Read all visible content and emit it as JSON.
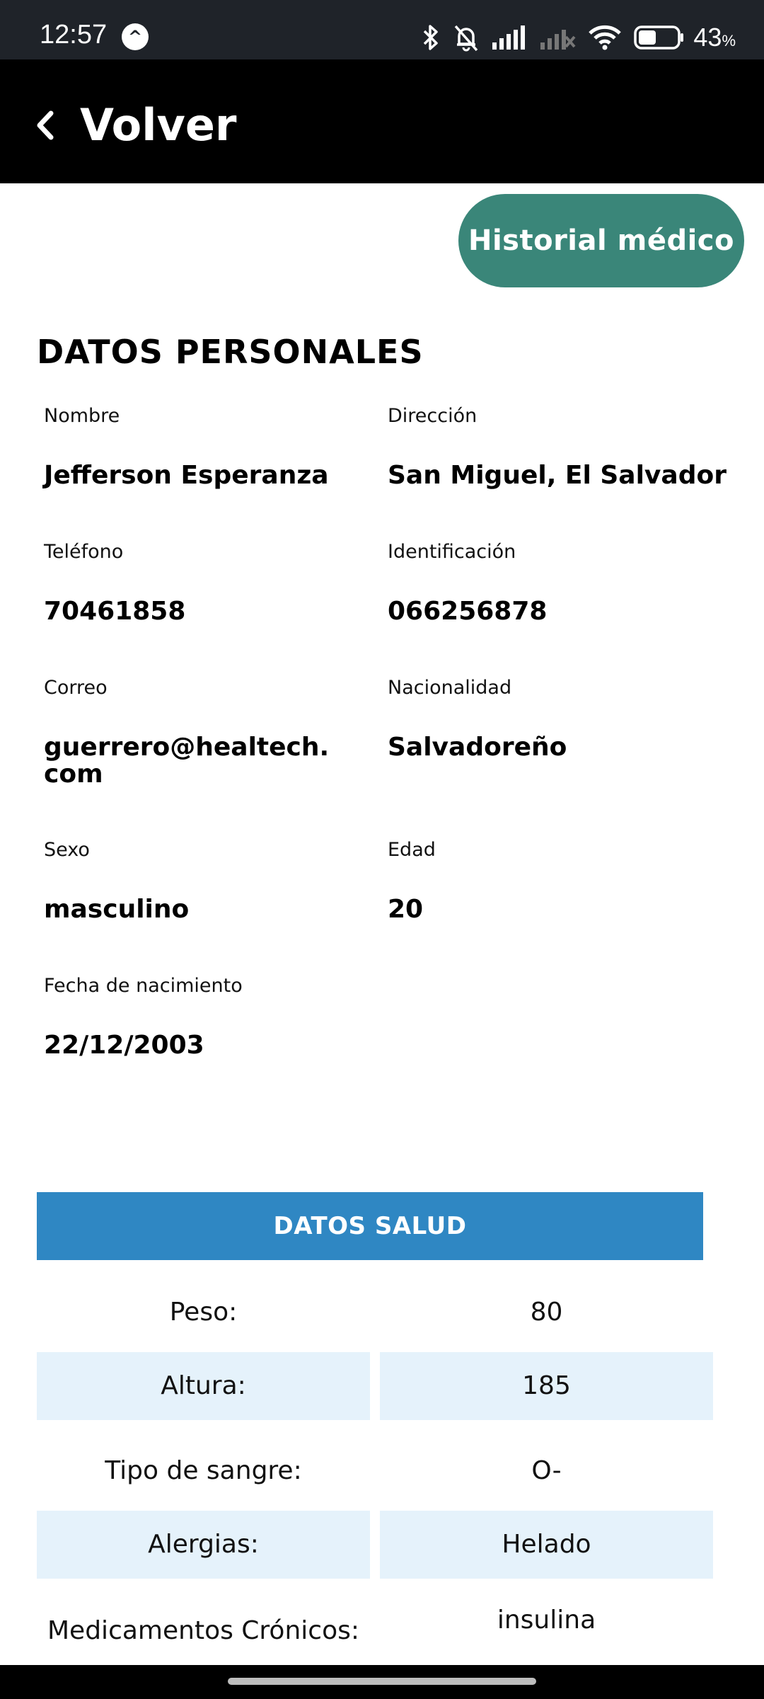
{
  "status_bar": {
    "time": "12:57",
    "app_icon_glyph": "^",
    "battery": "43",
    "battery_unit": "%",
    "icons": [
      "bluetooth-icon",
      "bell-muted-icon",
      "signal-icon",
      "signal-no-service-icon",
      "wifi-icon",
      "battery-icon"
    ]
  },
  "header": {
    "back_label": "Volver",
    "back_icon": "chevron-left-icon"
  },
  "history_button": {
    "label": "Historial médico",
    "color": "#3a8679"
  },
  "personal": {
    "title": "DATOS PERSONALES",
    "fields": [
      {
        "label": "Nombre",
        "value": "Jefferson Esperanza"
      },
      {
        "label": "Dirección",
        "value": "San Miguel, El Salvador"
      },
      {
        "label": "Teléfono",
        "value": "70461858"
      },
      {
        "label": "Identificación",
        "value": "066256878"
      },
      {
        "label": "Correo",
        "value": "guerrero@healtech.com"
      },
      {
        "label": "Nacionalidad",
        "value": "Salvadoreño"
      },
      {
        "label": "Sexo",
        "value": "masculino"
      },
      {
        "label": "Edad",
        "value": "20"
      },
      {
        "label": "Fecha de nacimiento",
        "value": "22/12/2003"
      }
    ]
  },
  "health": {
    "title": "DATOS SALUD",
    "header_color": "#2f87c3",
    "row_shade_color": "#e5f2fb",
    "rows": [
      {
        "key": "Peso:",
        "value": "80"
      },
      {
        "key": "Altura:",
        "value": "185"
      },
      {
        "key": "Tipo de sangre:",
        "value": "O-"
      },
      {
        "key": "Alergias:",
        "value": "Helado"
      },
      {
        "key": "Medicamentos Crónicos:",
        "value": "insulina"
      }
    ]
  }
}
